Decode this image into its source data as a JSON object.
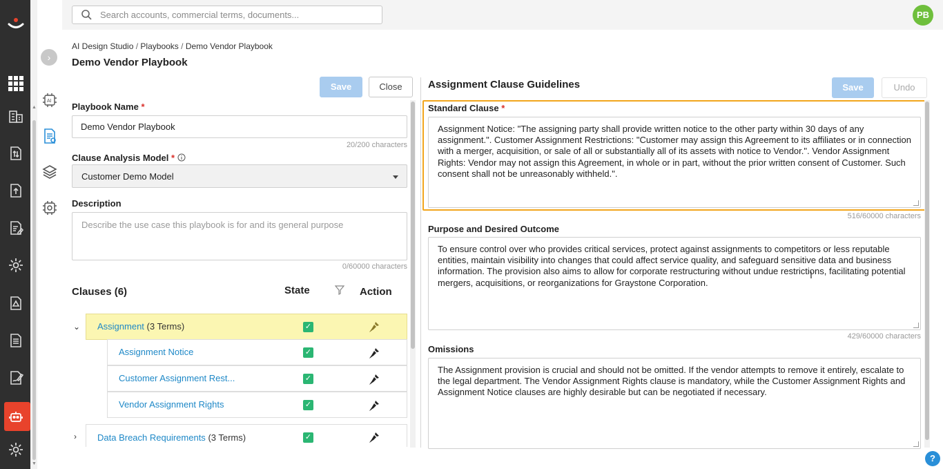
{
  "topbar": {
    "search_placeholder": "Search accounts, commercial terms, documents...",
    "avatar_initials": "PB"
  },
  "breadcrumb": {
    "items": [
      "AI Design Studio",
      "Playbooks",
      "Demo Vendor Playbook"
    ],
    "separator": "/"
  },
  "page_title": "Demo Vendor Playbook",
  "left_panel": {
    "save_label": "Save",
    "close_label": "Close",
    "playbook_name_label": "Playbook Name",
    "playbook_name_value": "Demo Vendor Playbook",
    "playbook_name_counter": "20/200 characters",
    "model_label": "Clause Analysis Model",
    "model_value": "Customer Demo Model",
    "description_label": "Description",
    "description_placeholder": "Describe the use case this playbook is for and its general purpose",
    "description_counter": "0/60000 characters",
    "clauses_title": "Clauses (6)",
    "state_header": "State",
    "action_header": "Action",
    "clauses": [
      {
        "name": "Assignment",
        "terms": "(3 Terms)",
        "expanded": true,
        "highlighted": true,
        "children": [
          {
            "name": "Assignment Notice"
          },
          {
            "name": "Customer Assignment Rest..."
          },
          {
            "name": "Vendor Assignment Rights"
          }
        ]
      },
      {
        "name": "Data Breach Requirements",
        "terms": "(3 Terms)",
        "expanded": false,
        "highlighted": false,
        "children": []
      }
    ]
  },
  "right_panel": {
    "title": "Assignment Clause Guidelines",
    "save_label": "Save",
    "undo_label": "Undo",
    "standard_clause_label": "Standard Clause",
    "standard_clause_text": "Assignment Notice: \"The assigning party shall provide written notice to the other party within 30 days of any assignment.\".  Customer Assignment Restrictions: \"Customer may assign this Agreement to its affiliates or in connection with a merger, acquisition, or sale of all or substantially all of its assets with notice to Vendor.\".  Vendor Assignment Rights: Vendor may not assign this Agreement, in whole or in part, without the prior written consent of Customer. Such consent shall not be unreasonably withheld.\".",
    "standard_clause_counter": "516/60000 characters",
    "purpose_label": "Purpose and Desired Outcome",
    "purpose_text": "To ensure control over who provides critical services, protect against assignments to competitors or less reputable entities, maintain visibility into changes that could affect service quality, and safeguard sensitive data and business information. The provision also aims to allow for corporate restructuring without undue restrictions, facilitating potential mergers, acquisitions, or reorganizations for Graystone Corporation.",
    "purpose_counter": "429/60000 characters",
    "omissions_label": "Omissions",
    "omissions_text": "The Assignment provision is crucial and should not be omitted. If the vendor attempts to remove it entirely, escalate to the legal department. The Vendor Assignment Rights clause is mandatory, while the Customer Assignment Rights and Assignment Notice clauses are highly desirable but can be negotiated if necessary."
  },
  "colors": {
    "accent": "#e8432c",
    "link": "#1e88c7",
    "check": "#2bb673",
    "focus": "#f2a51c",
    "highlight_row": "#fbf6b2",
    "primary_button": "#a9ccef"
  },
  "help_label": "?"
}
